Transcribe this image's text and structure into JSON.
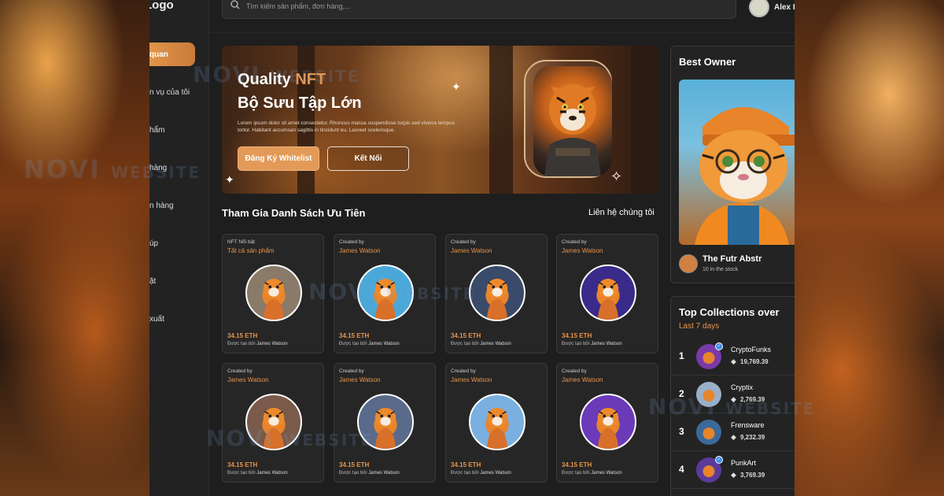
{
  "app": {
    "logo": "Logo"
  },
  "sidebar": {
    "items": [
      {
        "label": "quan",
        "active": true
      },
      {
        "label": "n vụ của tôi"
      },
      {
        "label": "hẩm"
      },
      {
        "label": "hàng"
      },
      {
        "label": "n hàng"
      },
      {
        "label": "úp"
      },
      {
        "label": "ặt"
      },
      {
        "label": "xuất"
      }
    ]
  },
  "header": {
    "search_placeholder": "Tìm kiếm sản phẩm, đơn hàng,...",
    "user_name": "Alex F"
  },
  "hero": {
    "title_prefix": "Quality ",
    "title_accent": "NFT",
    "title_line2": "Bộ Sưu Tập Lớn",
    "description": "Lorem ipsum dolor sit amet consectetur. Rhoncus massa suspendisse turpis sed viverra tempus tortor. Habitant accumsan sagittis in tincidunt eu. Laoreet scelerisque.",
    "primary_button": "Đăng Ký Whitelist",
    "secondary_button": "Kết Nối"
  },
  "section": {
    "title": "Tham Gia Danh Sách Ưu Tiên",
    "link": "Liên hệ chúng tôi"
  },
  "nfts": [
    {
      "caption": "NFT Nổi bật",
      "name": "Tất cả sản phẩm",
      "price": "34.15 ETH",
      "owner_prefix": "Được tạo bởi",
      "owner": "James Watson",
      "bg": "#8a7a6a"
    },
    {
      "caption": "Created by",
      "name": "James Watson",
      "price": "34.15 ETH",
      "owner_prefix": "Được tạo bởi",
      "owner": "James Watson",
      "bg": "#4aa8d8"
    },
    {
      "caption": "Created by",
      "name": "James Watson",
      "price": "34.15 ETH",
      "owner_prefix": "Được tạo bởi",
      "owner": "James Watson",
      "bg": "#3a4a6a"
    },
    {
      "caption": "Created by",
      "name": "James Watson",
      "price": "34.15 ETH",
      "owner_prefix": "Được tạo bởi",
      "owner": "James Watson",
      "bg": "#3a2a8a"
    },
    {
      "caption": "Created by",
      "name": "James Watson",
      "price": "34.15 ETH",
      "owner_prefix": "Được tạo bởi",
      "owner": "James Watson",
      "bg": "#7a5a4a"
    },
    {
      "caption": "Created by",
      "name": "James Watson",
      "price": "34.15 ETH",
      "owner_prefix": "Được tạo bởi",
      "owner": "James Watson",
      "bg": "#5a6a8a"
    },
    {
      "caption": "Created by",
      "name": "James Watson",
      "price": "34.15 ETH",
      "owner_prefix": "Được tạo bởi",
      "owner": "James Watson",
      "bg": "#7ab0e0"
    },
    {
      "caption": "Created by",
      "name": "James Watson",
      "price": "34.15 ETH",
      "owner_prefix": "Được tạo bởi",
      "owner": "James Watson",
      "bg": "#6a3ab8"
    }
  ],
  "best_owner": {
    "title": "Best Owner",
    "name": "The Futr Abstr",
    "stock": "10 in the stock"
  },
  "top_collections": {
    "title": "Top Collections over",
    "subtitle": "Last 7 days",
    "items": [
      {
        "rank": "1",
        "name": "CryptoFunks",
        "value": "19,769.39",
        "verified": true,
        "bg": "#7a3aa8"
      },
      {
        "rank": "2",
        "name": "Cryptix",
        "value": "2,769.39",
        "verified": false,
        "bg": "#9ab0c8"
      },
      {
        "rank": "3",
        "name": "Frensware",
        "value": "9,232.39",
        "verified": false,
        "bg": "#3a6a9a"
      },
      {
        "rank": "4",
        "name": "PunkArt",
        "value": "3,769.39",
        "verified": true,
        "bg": "#5a3a9a"
      }
    ]
  },
  "watermark": {
    "novi": "NOVI",
    "website": "WEBSITE"
  },
  "colors": {
    "accent": "#e8944a",
    "background": "#1e1e1e",
    "card": "#262626"
  }
}
